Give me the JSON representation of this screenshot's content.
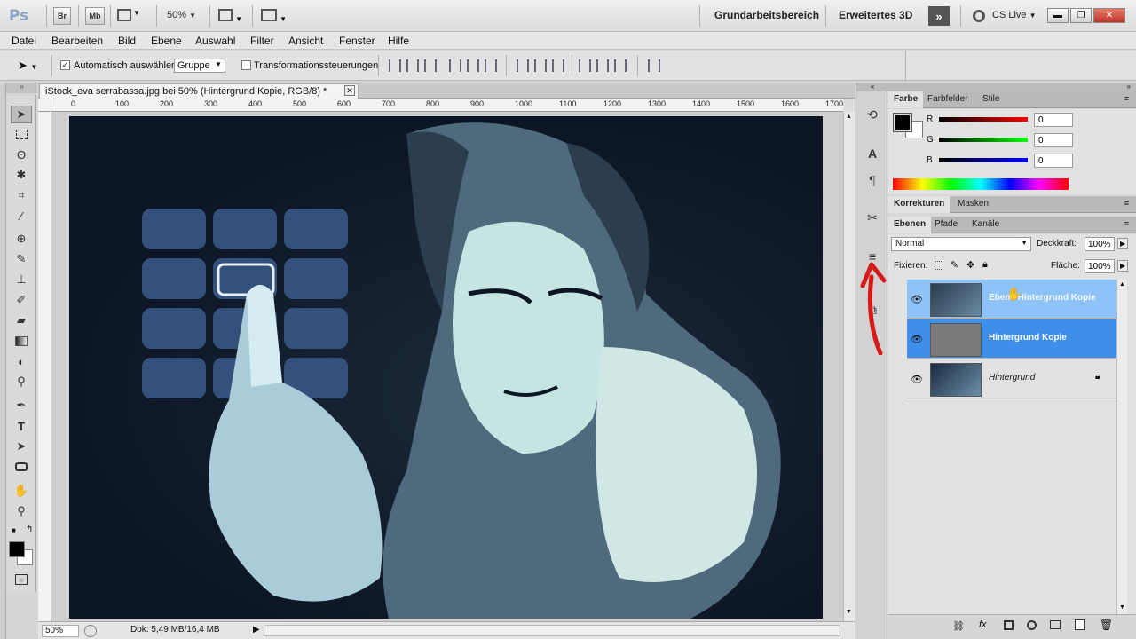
{
  "app": {
    "logo": "Ps",
    "bridge": "Br",
    "minibridge": "Mb",
    "zoom": "50%"
  },
  "workspace": {
    "primary": "Grundarbeitsbereich",
    "secondary": "Erweitertes 3D",
    "cslive": "CS Live"
  },
  "menu": [
    "Datei",
    "Bearbeiten",
    "Bild",
    "Ebene",
    "Auswahl",
    "Filter",
    "Ansicht",
    "Fenster",
    "Hilfe"
  ],
  "options": {
    "auto_select_label": "Automatisch auswählen:",
    "auto_select_value": "Gruppe",
    "transform_label": "Transformationssteuerungen",
    "auto_select_checked": true,
    "transform_checked": false
  },
  "document": {
    "tab_title": "iStock_eva serrabassa.jpg bei 50% (Hintergrund Kopie, RGB/8) *",
    "ruler_ticks": [
      "0",
      "100",
      "200",
      "300",
      "400",
      "500",
      "600",
      "700",
      "800",
      "900",
      "1000",
      "1100",
      "1200",
      "1300",
      "1400",
      "1500",
      "1600",
      "1700"
    ]
  },
  "status": {
    "zoom": "50%",
    "doc_info": "Dok: 5,49 MB/16,4 MB"
  },
  "color_panel": {
    "tabs": [
      "Farbe",
      "Farbfelder",
      "Stile"
    ],
    "channels": [
      {
        "label": "R",
        "value": "0"
      },
      {
        "label": "G",
        "value": "0"
      },
      {
        "label": "B",
        "value": "0"
      }
    ]
  },
  "adjust_panel": {
    "tabs": [
      "Korrekturen",
      "Masken"
    ]
  },
  "layers_panel": {
    "tabs": [
      "Ebenen",
      "Pfade",
      "Kanäle"
    ],
    "blend_mode": "Normal",
    "opacity_label": "Deckkraft:",
    "opacity": "100%",
    "lock_label": "Fixieren:",
    "fill_label": "Fläche:",
    "fill": "100%",
    "layers": [
      {
        "name": "Ebene Hintergrund Kopie",
        "state": "dragging"
      },
      {
        "name": "Hintergrund Kopie",
        "state": "selected"
      },
      {
        "name": "Hintergrund",
        "state": "normal",
        "locked": true
      }
    ]
  },
  "colors": {
    "accent": "#3d8fe8",
    "highlight": "#8ec3f7",
    "annotation": "#d61a1a"
  }
}
